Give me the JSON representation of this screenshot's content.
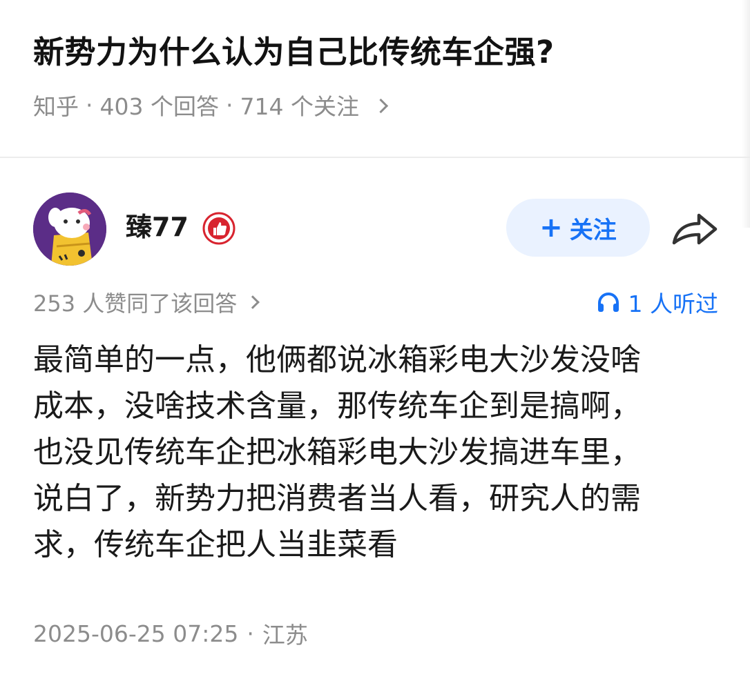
{
  "question": {
    "title": "新势力为什么认为自己比传统车企强?",
    "source": "知乎",
    "separator": "·",
    "answers_count": "403 个回答",
    "followers_count": "714 个关注"
  },
  "author": {
    "name": "臻77",
    "follow_label": "关注",
    "follow_plus": "+"
  },
  "stats": {
    "upvotes": "253 人赞同了该回答",
    "listeners": "1 人听过"
  },
  "answer": {
    "lines": [
      "最简单的一点，他俩都说冰箱彩电大沙发没啥",
      "成本，没啥技术含量，那传统车企到是搞啊，",
      "也没见传统车企把冰箱彩电大沙发搞进车里，",
      "说白了，新势力把消费者当人看，研究人的需",
      "求，传统车企把人当韭菜看"
    ]
  },
  "footer": {
    "datetime": "2025-06-25 07:25",
    "separator": "·",
    "location": "江苏"
  },
  "colors": {
    "accent": "#1772f6",
    "follow_bg": "#eaf2ff",
    "meta_text": "#8c8c8c",
    "badge_red": "#d8242f",
    "avatar_bg": "#5b2d87"
  },
  "icons": {
    "meta_chevron": "chevron-right-icon",
    "badge": "thumbs-up-badge-icon",
    "share": "share-arrow-icon",
    "listen": "headphones-icon"
  }
}
